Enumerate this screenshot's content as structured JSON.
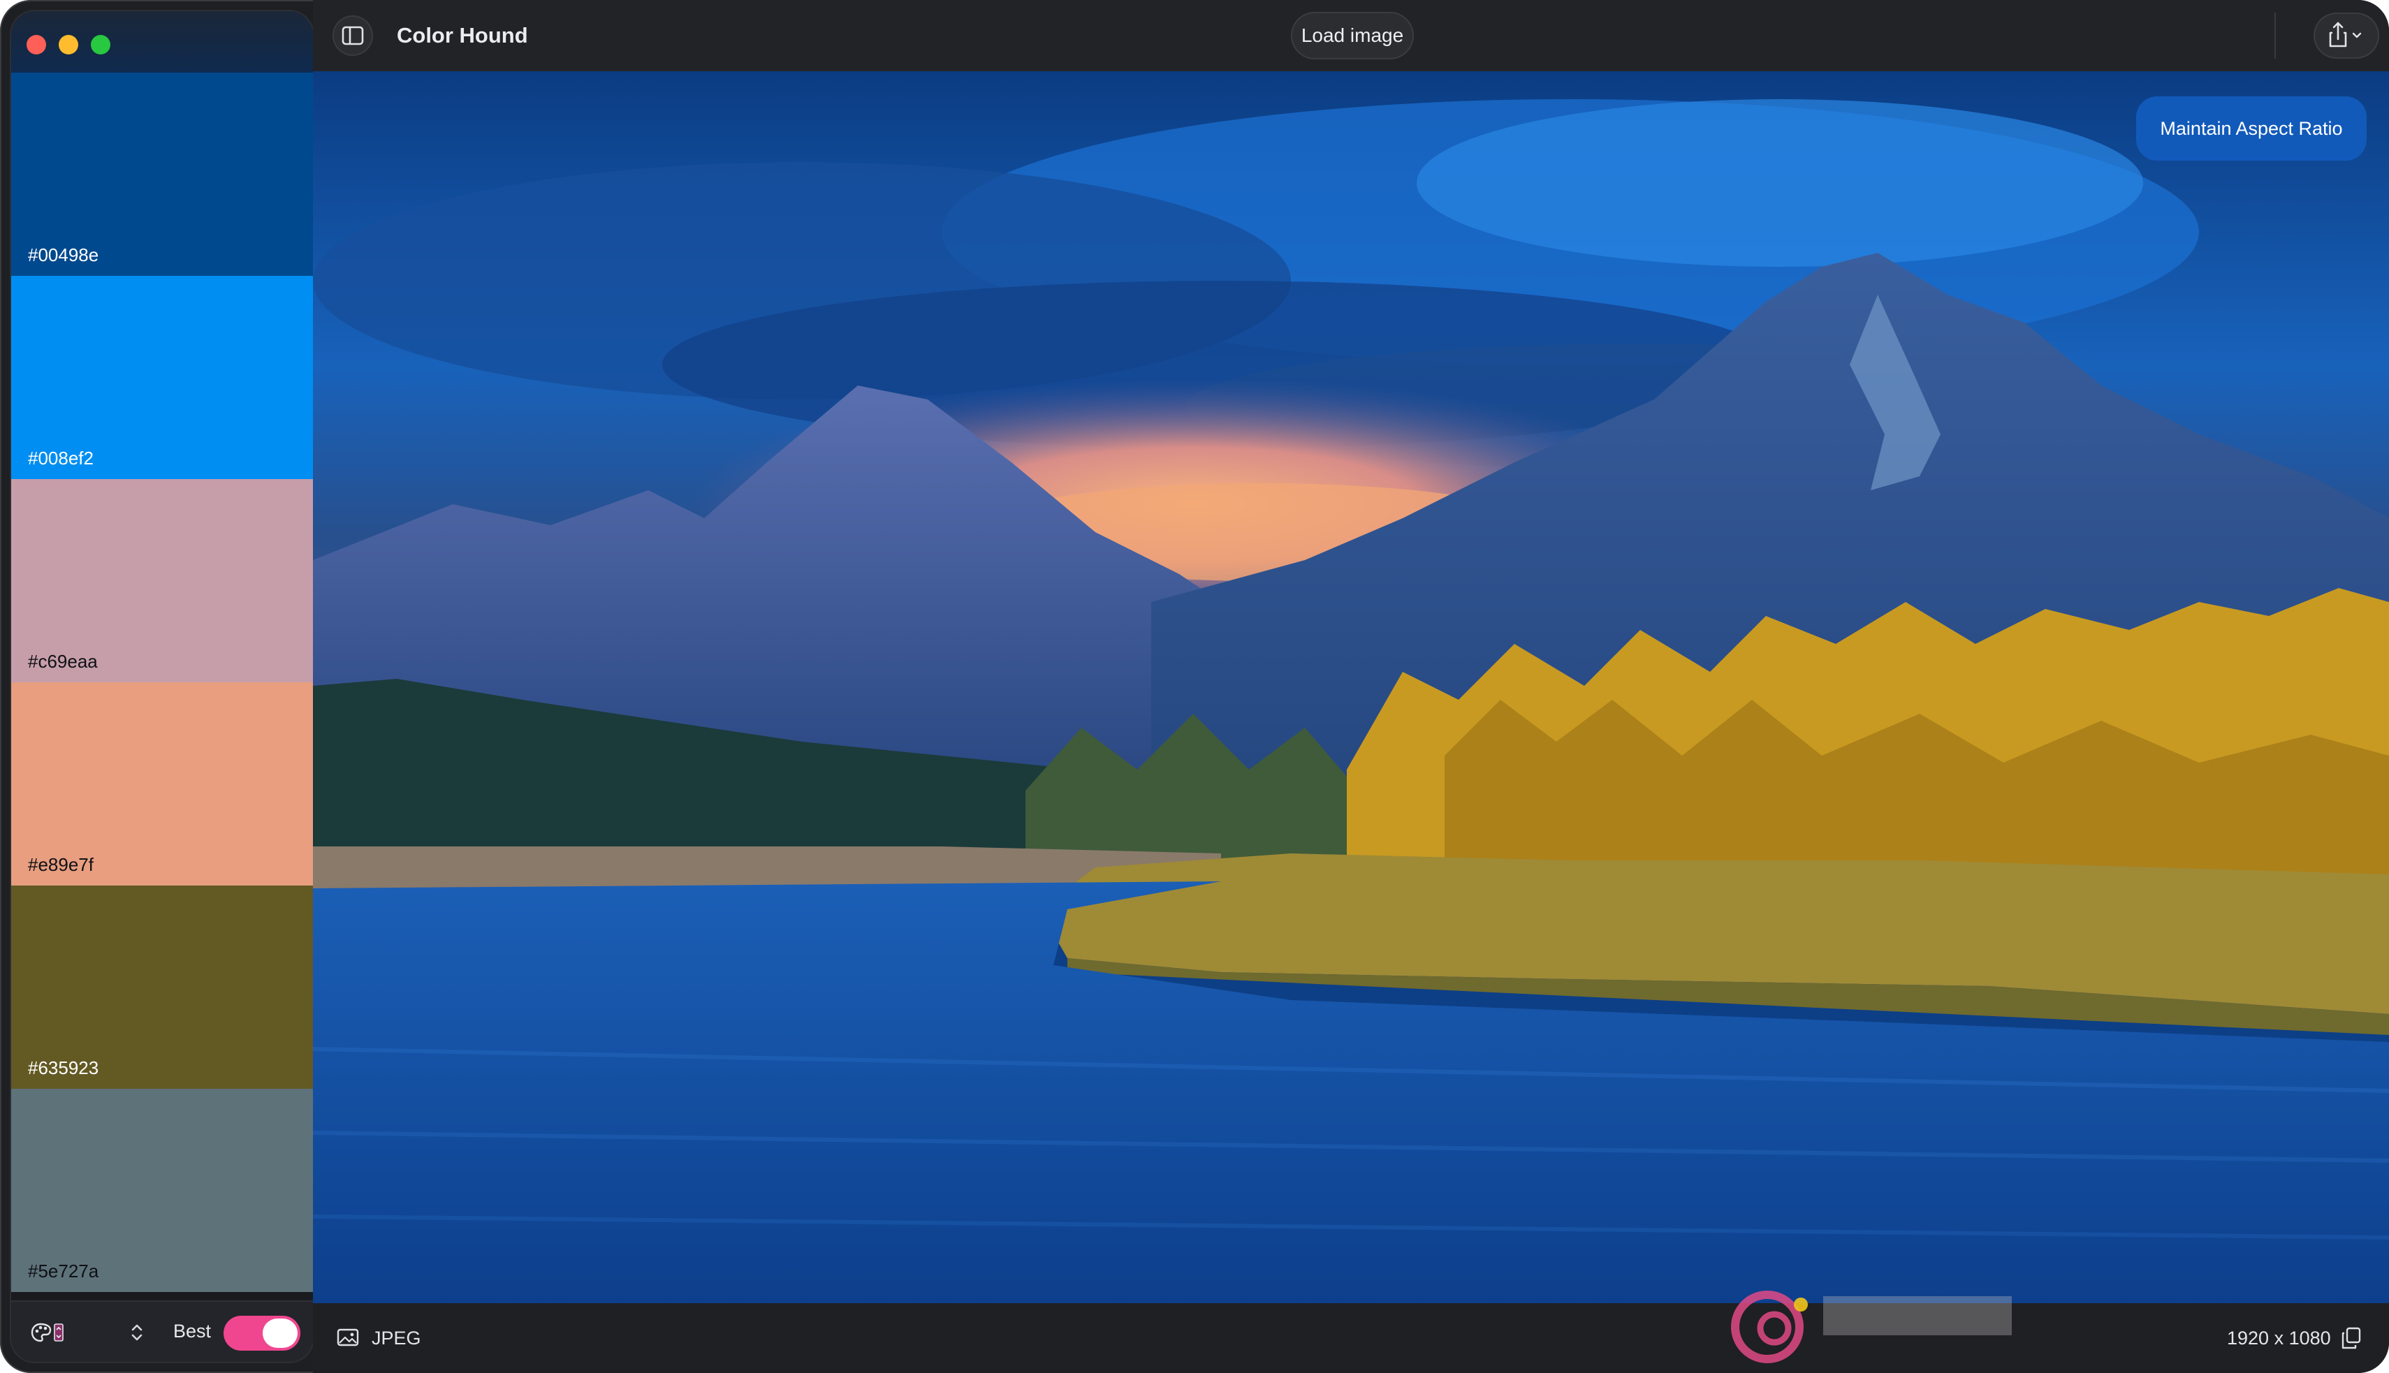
{
  "window": {
    "title": "Color Hound",
    "traffic_lights": [
      "close",
      "minimize",
      "zoom"
    ]
  },
  "toolbar": {
    "sidebar_toggle_icon": "sidebar-toggle-icon",
    "title": "Color Hound",
    "load_image_label": "Load image",
    "share_icon": "share-icon"
  },
  "palette": {
    "swatches": [
      {
        "hex": "#00498e",
        "color": "#00498e"
      },
      {
        "hex": "#008ef2",
        "color": "#008ef2"
      },
      {
        "hex": "#c69eaa",
        "color": "#c69eaa"
      },
      {
        "hex": "#e89e7f",
        "color": "#e89e7f"
      },
      {
        "hex": "#635923",
        "color": "#635923"
      },
      {
        "hex": "#5e727a",
        "color": "#5e727a"
      }
    ]
  },
  "sidebar_controls": {
    "palette_icon": "palette-icon",
    "stepper_icon": "up-down-stepper-icon",
    "quality_label": "Best",
    "quality_toggle_on": true,
    "toggle_color": "#f0468f"
  },
  "viewer": {
    "maintain_aspect_label": "Maintain Aspect Ratio"
  },
  "status": {
    "image_icon": "photo-icon",
    "format": "JPEG",
    "dimensions": "1920 x 1080",
    "copy_icon": "copy-icon"
  }
}
